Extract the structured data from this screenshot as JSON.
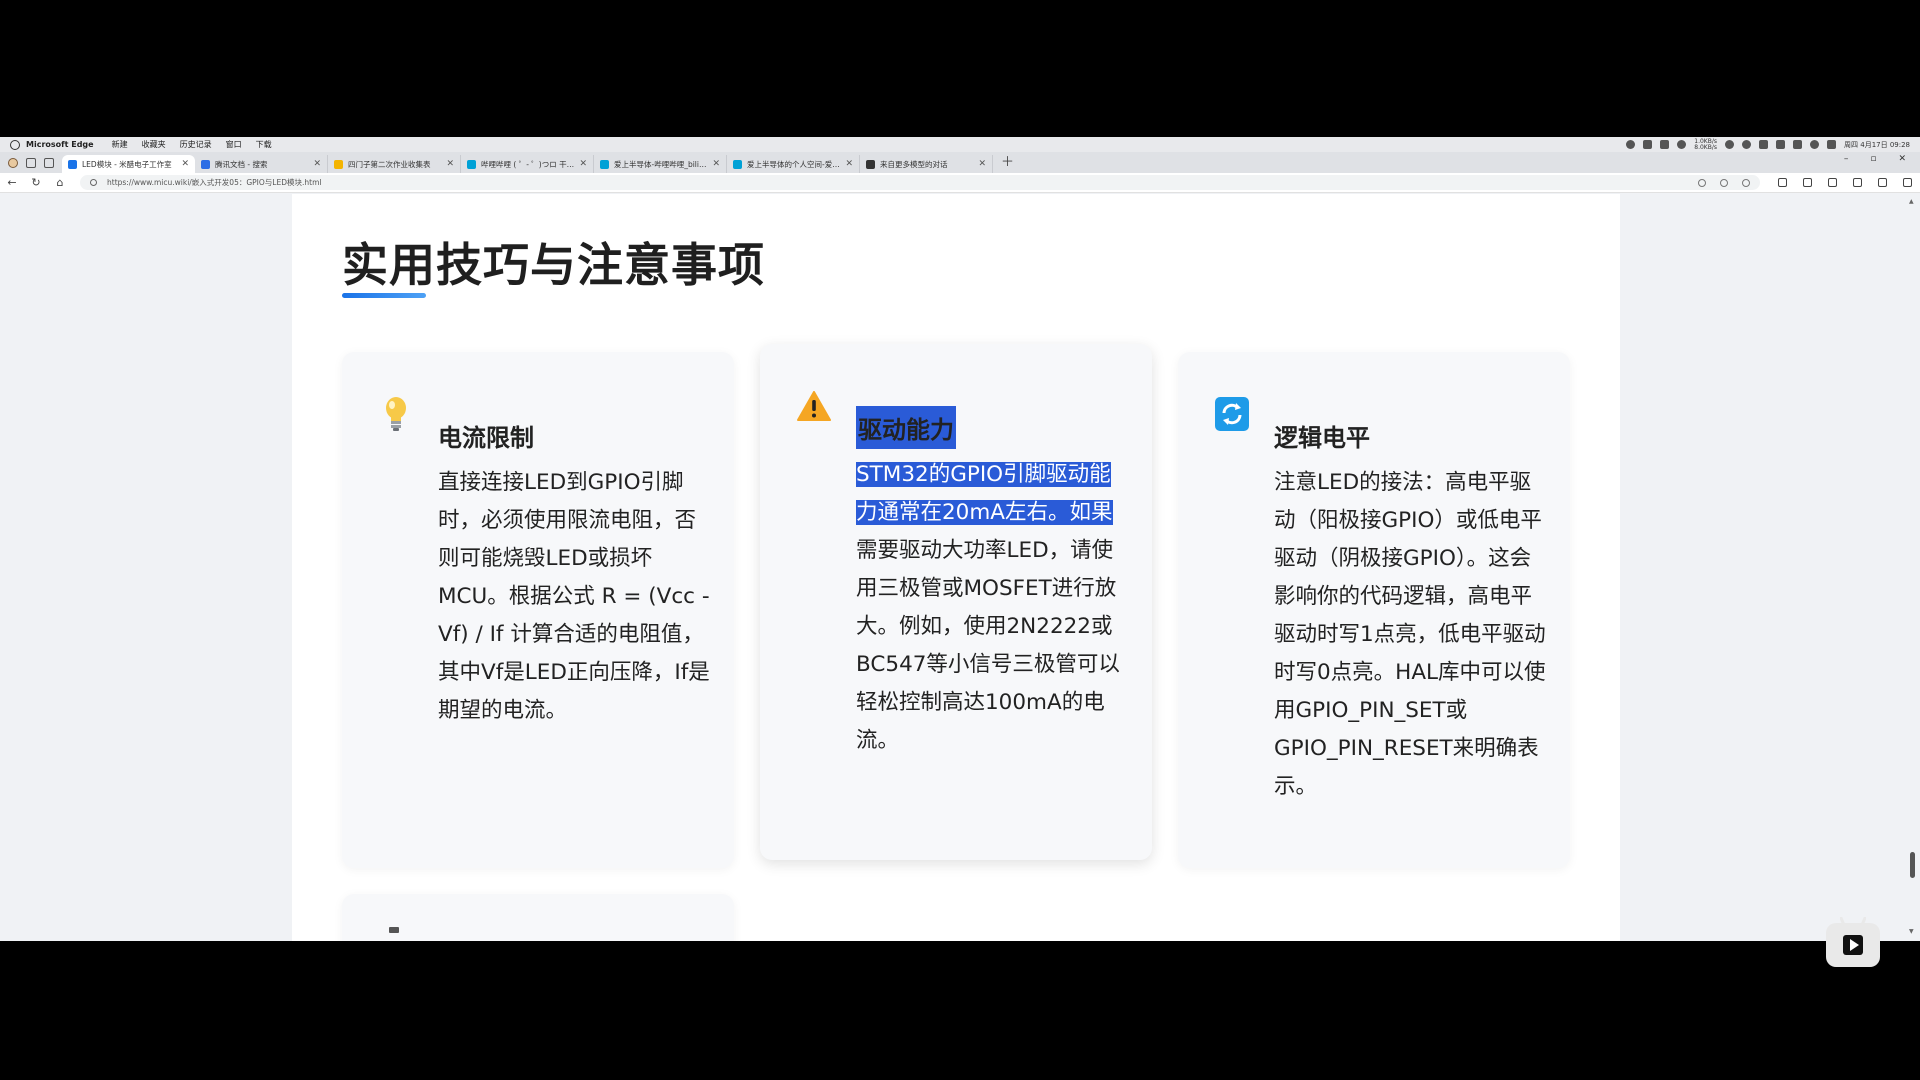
{
  "browser": {
    "app_name": "Microsoft Edge",
    "menu": [
      "新建",
      "收藏夹",
      "历史记录",
      "窗口",
      "下载"
    ],
    "clock": "周四 4月17日 09:28",
    "net_up": "1.0KB/s",
    "net_down": "8.0KB/s",
    "tabs": [
      {
        "label": "LED模块 - 米醋电子工作室",
        "color": "#1a73e8",
        "active": true
      },
      {
        "label": "腾讯文档 - 搜索",
        "color": "#2b6de5",
        "active": false
      },
      {
        "label": "四门子第二次作业收集表",
        "color": "#f4b400",
        "active": false
      },
      {
        "label": "哔哩哔哩 ( ゜- ゜)つロ 干杯~-bilibili",
        "color": "#00a1d6",
        "active": false
      },
      {
        "label": "爱上半导体-哔哩哔哩_bilibili",
        "color": "#00a1d6",
        "active": false
      },
      {
        "label": "爱上半导体的个人空间-爱上半导体",
        "color": "#00a1d6",
        "active": false
      },
      {
        "label": "来自更多模型的对话",
        "color": "#333333",
        "active": false
      }
    ],
    "url": "https://www.micu.wiki/嵌入式开发05：GPIO与LED模块.html"
  },
  "page": {
    "heading": "实用技巧与注意事项",
    "cards": [
      {
        "icon": "lightbulb-icon",
        "title": "电流限制",
        "body": "直接连接LED到GPIO引脚时，必须使用限流电阻，否则可能烧毁LED或损坏MCU。根据公式 R = (Vcc - Vf) / If 计算合适的电阻值，其中Vf是LED正向压降，If是期望的电流。"
      },
      {
        "icon": "warning-icon",
        "title": "驱动能力",
        "body_selected": "STM32的GPIO引脚驱动能力通常在20mA左右。如果",
        "body_rest": "需要驱动大功率LED，请使用三极管或MOSFET进行放大。例如，使用2N2222或BC547等小信号三极管可以轻松控制高达100mA的电流。"
      },
      {
        "icon": "sync-icon",
        "title": "逻辑电平",
        "body": "注意LED的接法：高电平驱动（阳极接GPIO）或低电平驱动（阴极接GPIO）。这会影响你的代码逻辑，高电平驱动时写1点亮，低电平驱动时写0点亮。HAL库中可以使用GPIO_PIN_SET或GPIO_PIN_RESET来明确表示。"
      }
    ]
  },
  "colors": {
    "accent": "#1a73e8",
    "selection": "#2a5bd7",
    "warning": "#f5a623",
    "sync": "#1e9be8"
  }
}
